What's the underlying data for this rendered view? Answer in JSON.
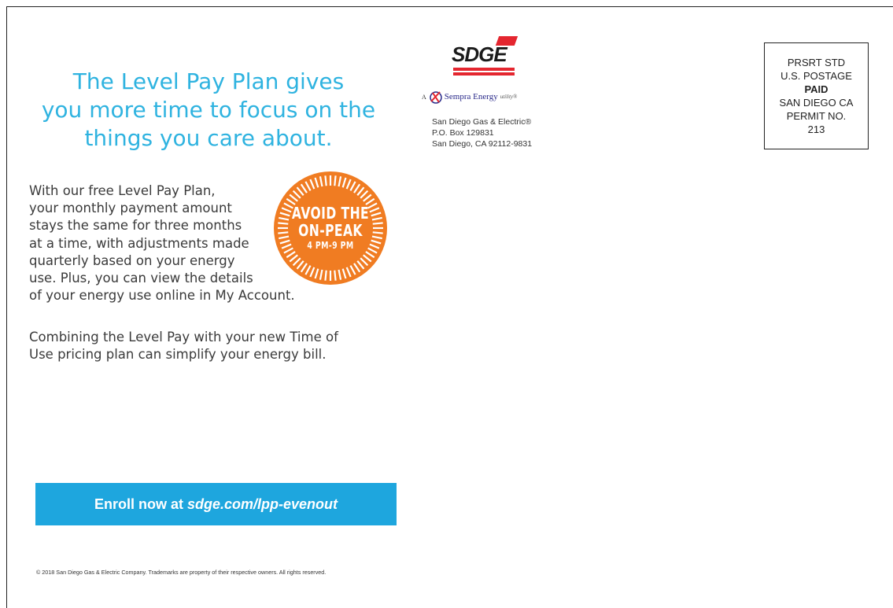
{
  "headline": {
    "lines": [
      "The Level Pay Plan gives",
      "you more time to focus on the",
      "things you care about."
    ]
  },
  "body": {
    "paragraph1": [
      "With our free Level Pay Plan,",
      "your monthly payment amount",
      "stays the same for three months",
      "at a time, with adjustments made",
      "quarterly based on your energy",
      "use. Plus, you can view the details",
      "of your energy use online in My Account."
    ],
    "paragraph2": [
      "Combining the Level Pay with your new Time of",
      "Use pricing plan can simplify your energy bill."
    ]
  },
  "badge": {
    "line1": "AVOID THE",
    "line2": "ON-PEAK",
    "line3": "4 PM-9 PM",
    "color": "#f07c22"
  },
  "cta": {
    "prefix": "Enroll now at",
    "url": "sdge.com/lpp-evenout",
    "color": "#1ea6de"
  },
  "footer": {
    "copyright": "© 2018 San Diego Gas & Electric Company. Trademarks are property of their respective owners. All rights reserved."
  },
  "logo": {
    "brand": "SDGE",
    "sempra_prefix": "A",
    "sempra_name": "Sempra Energy",
    "sempra_suffix": "utility®",
    "icon": "sempra-logo-icon"
  },
  "return_address": {
    "lines": [
      "San Diego Gas & Electric®",
      "P.O. Box 129831",
      "San Diego, CA 92112-9831"
    ]
  },
  "postage": {
    "line1": "PRSRT STD",
    "line2": "U.S. POSTAGE",
    "line3": "PAID",
    "line4": "SAN DIEGO CA",
    "line5": "PERMIT NO.",
    "line6": "213"
  }
}
